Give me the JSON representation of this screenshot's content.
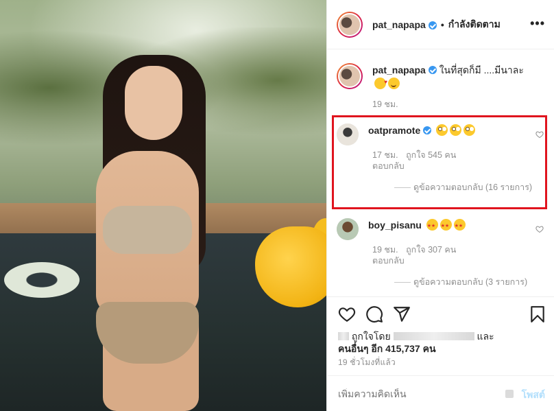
{
  "post": {
    "author": "pat_napapa",
    "follow_status": "กำลังติดตาม",
    "more_label": "•••"
  },
  "caption": {
    "username": "pat_napapa",
    "text": "ในที่สุดก็มี ....มีนาละ",
    "emoji": [
      "smiling-face-with-hearts",
      "smiling-face"
    ],
    "time": "19 ชม."
  },
  "comments": [
    {
      "username": "oatpramote",
      "emoji": [
        "flushed-face",
        "flushed-face",
        "flushed-face"
      ],
      "time": "17 ชม.",
      "likes": "ถูกใจ 545 คน",
      "reply_label": "ตอบกลับ",
      "view_replies": "ดูข้อความตอบกลับ (16 รายการ)"
    },
    {
      "username": "boy_pisanu",
      "emoji": [
        "star-struck",
        "star-struck",
        "star-struck"
      ],
      "time": "19 ชม.",
      "likes": "ถูกใจ 307 คน",
      "reply_label": "ตอบกลับ",
      "view_replies": "ดูข้อความตอบกลับ (3 รายการ)"
    }
  ],
  "likes_section": {
    "liked_by_prefix": "ถูกใจโดย",
    "and_label": "และ",
    "others_label": "คนอื่นๆ อีก 415,737 คน"
  },
  "timestamp": "19 ชั่วโมงที่แล้ว",
  "add_comment": {
    "placeholder": "เพิ่มความคิดเห็น",
    "post_label": "โพสต์"
  },
  "colors": {
    "verified": "#3897f0",
    "highlight_border": "#e0141e",
    "post_button": "#b2dffc",
    "muted_text": "#8e8e8e"
  },
  "icons": [
    "heart-icon",
    "comment-icon",
    "share-icon",
    "bookmark-icon",
    "verified-badge-icon",
    "more-icon"
  ]
}
